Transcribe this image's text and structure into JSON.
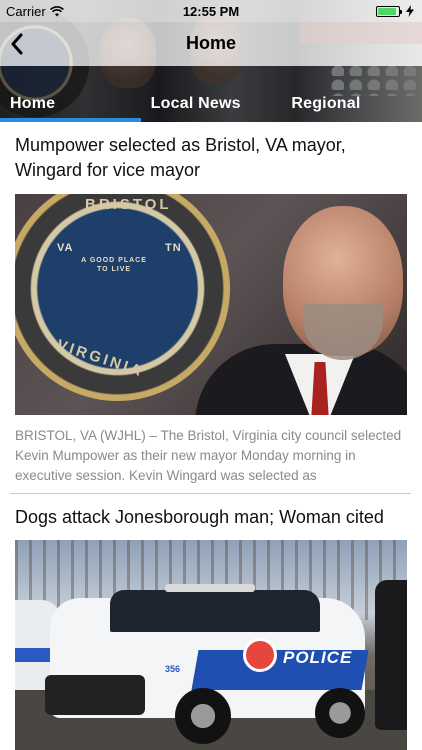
{
  "status_bar": {
    "carrier": "Carrier",
    "time": "12:55 PM",
    "battery_level": 0.9,
    "signal_icon": "wifi-icon",
    "charging_icon": "bolt-icon"
  },
  "navbar": {
    "title": "Home",
    "back_icon": "chevron-left-icon"
  },
  "tabs": [
    {
      "label": "Home",
      "active": true
    },
    {
      "label": "Local News",
      "active": false
    },
    {
      "label": "Regional",
      "active": false
    }
  ],
  "articles": [
    {
      "headline": "Mumpower selected as Bristol, VA mayor, Wingard for vice mayor",
      "summary": "BRISTOL, VA (WJHL) – The Bristol, Virginia city council selected Kevin Mumpower as their new mayor Monday morning in executive session. Kevin Wingard was selected as",
      "image": {
        "seal_top": "BRISTOL",
        "seal_left": "VA",
        "seal_right": "TN",
        "seal_center": "A GOOD PLACE TO LIVE",
        "seal_bottom": "VIRGINIA"
      }
    },
    {
      "headline": "Dogs attack Jonesborough man; Woman cited",
      "image": {
        "car_text": "POLICE",
        "car_number": "356"
      }
    }
  ],
  "colors": {
    "tab_active_underline": "#2a8be3",
    "battery_fill": "#4cd964",
    "summary_text": "#8a8a8a"
  }
}
